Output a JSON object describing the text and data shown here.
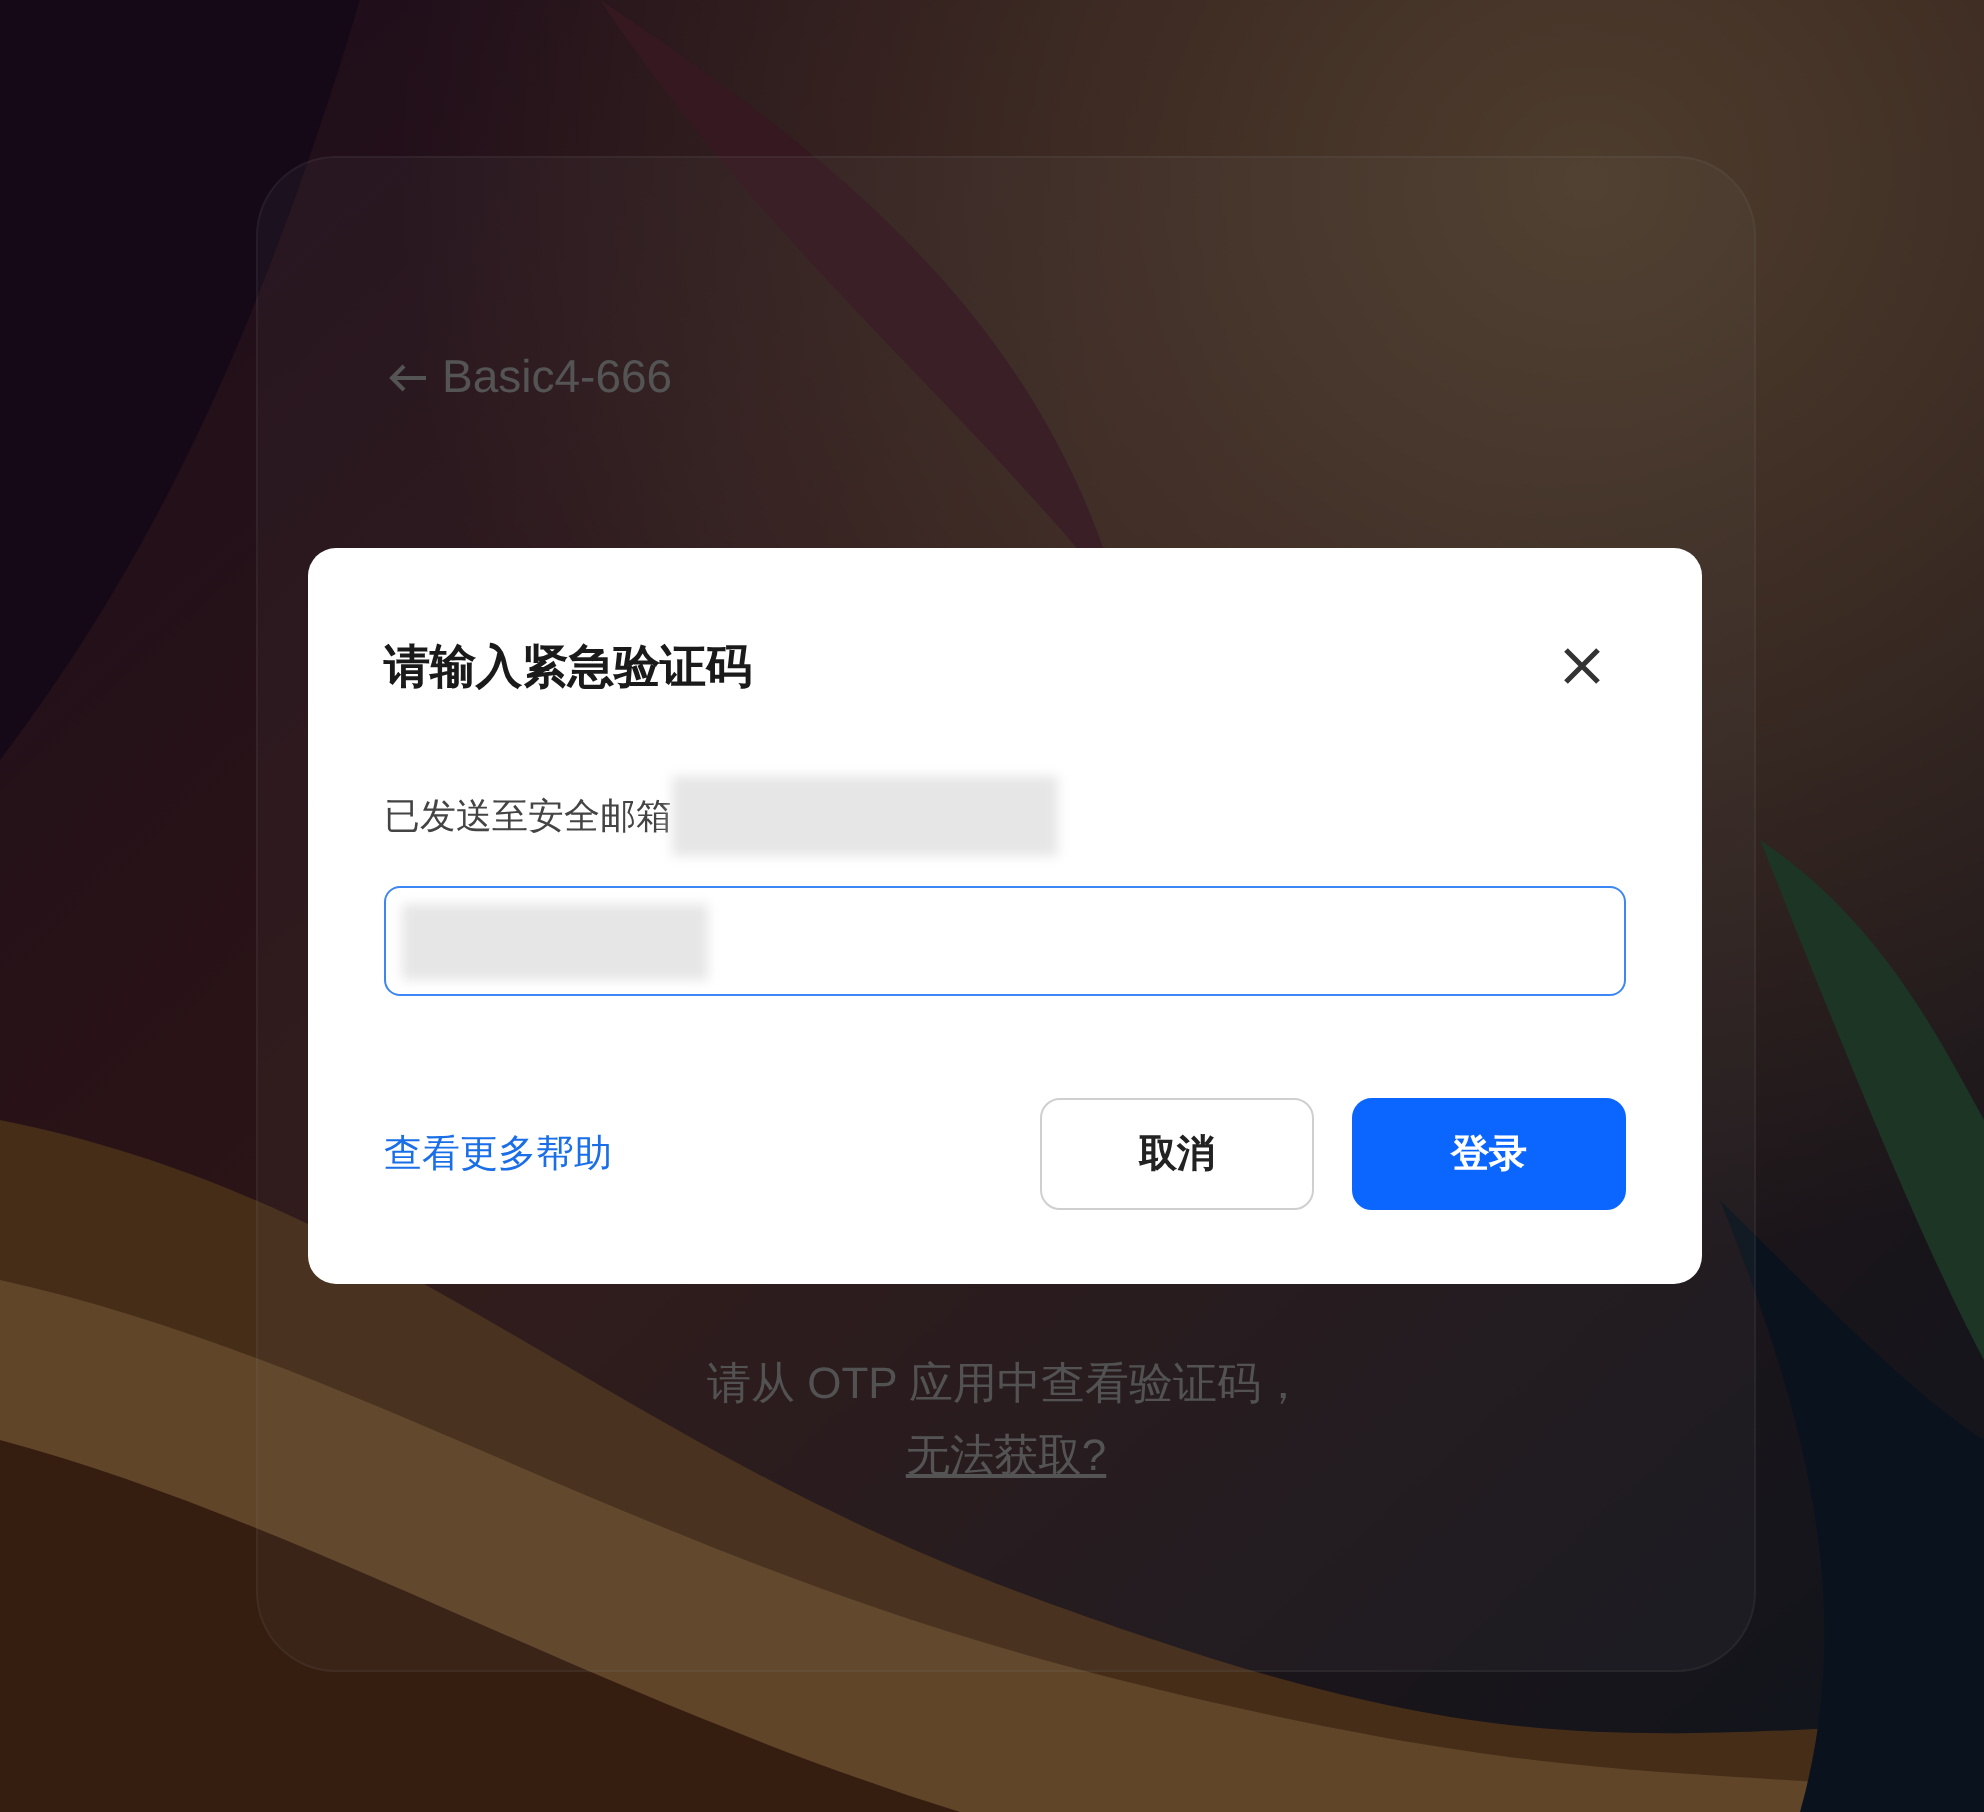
{
  "background_page": {
    "back_link": "Basic4-666",
    "hint": "请从 OTP 应用中查看验证码，",
    "help_link": "无法获取?"
  },
  "dialog": {
    "title": "请输入紧急验证码",
    "sent_notice": "已发送至安全邮箱",
    "code_field": {
      "focused": true
    },
    "help_link": "查看更多帮助",
    "buttons": [
      {
        "label": "取消",
        "kind": "secondary"
      },
      {
        "label": "登录",
        "kind": "primary"
      }
    ]
  }
}
